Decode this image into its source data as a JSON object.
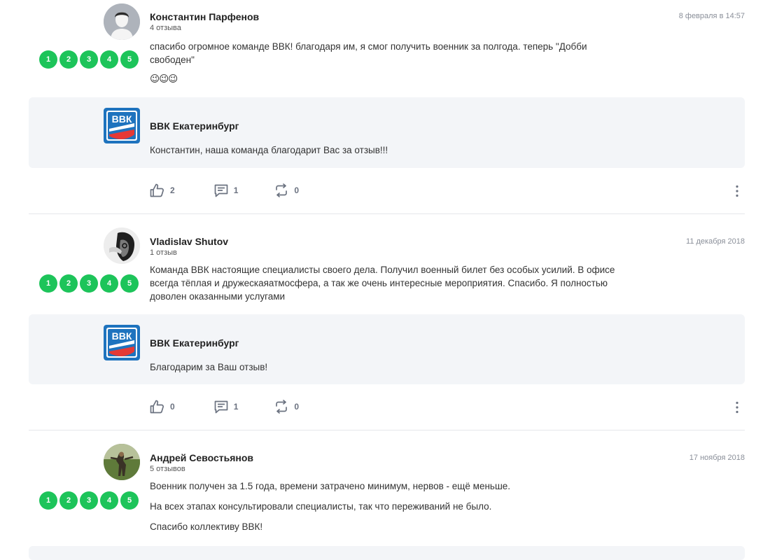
{
  "reviews": [
    {
      "author": "Константин Парфенов",
      "review_count": "4 отзыва",
      "date": "8 февраля в 14:57",
      "rating": [
        "1",
        "2",
        "3",
        "4",
        "5"
      ],
      "text_lines": [
        "спасибо огромное команде ВВК! благодаря им, я смог получить военник за полгода. теперь \"Добби свободен\""
      ],
      "emoji": "😉😉😉",
      "reply": {
        "author": "ВВК Екатеринбург",
        "text": "Константин, наша команда благодарит Вас за отзыв!!!"
      },
      "likes": "2",
      "comments": "1",
      "shares": "0"
    },
    {
      "author": "Vladislav Shutov",
      "review_count": "1 отзыв",
      "date": "11 декабря 2018",
      "rating": [
        "1",
        "2",
        "3",
        "4",
        "5"
      ],
      "text_lines": [
        "Команда ВВК настоящие специалисты своего дела. Получил военный билет без особых усилий. В офисе всегда тёплая и дружескаяатмосфера, а так же очень интересные мероприятия. Спасибо. Я полностью доволен оказанными услугами"
      ],
      "reply": {
        "author": "ВВК Екатеринбург",
        "text": "Благодарим за Ваш отзыв!"
      },
      "likes": "0",
      "comments": "1",
      "shares": "0"
    },
    {
      "author": "Андрей Севостьянов",
      "review_count": "5 отзывов",
      "date": "17 ноября 2018",
      "rating": [
        "1",
        "2",
        "3",
        "4",
        "5"
      ],
      "text_lines": [
        "Военник получен за 1.5 года, времени затрачено минимум, нервов - ещё меньше.",
        "На всех этапах консультировали специалисты, так что переживаний не было.",
        "Спасибо коллективу ВВК!"
      ]
    }
  ],
  "logo_text": "ВВК",
  "icons": {
    "like": "thumbs-up-icon",
    "comment": "comment-icon",
    "share": "repost-icon",
    "more": "more-vertical-icon"
  },
  "colors": {
    "rating_green": "#1dc45a",
    "reply_bg": "#f3f5f8",
    "icon_gray": "#6b7280",
    "logo_blue": "#1e73be"
  }
}
